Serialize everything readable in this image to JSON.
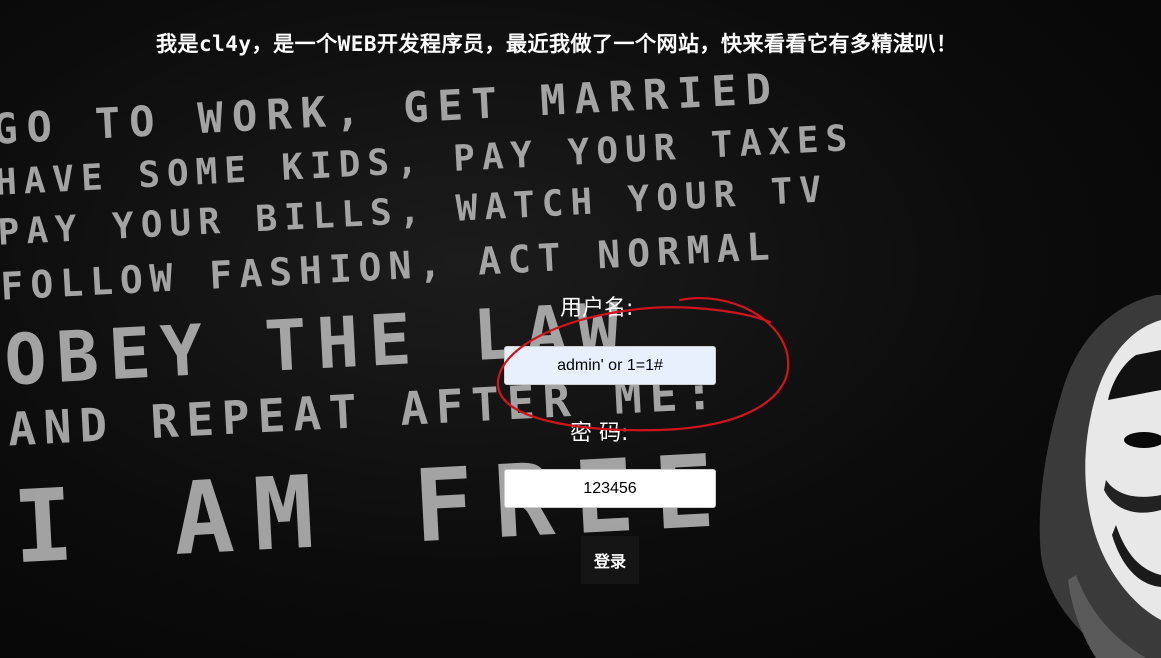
{
  "header": {
    "intro_text": "我是cl4y，是一个WEB开发程序员，最近我做了一个网站，快来看看它有多精湛叭！"
  },
  "background_poster": {
    "lines": [
      "Go to work, get married",
      "Have some kids, pay your taxes",
      "Pay your bills, watch your TV",
      "Follow fashion, act normal",
      "Obey the law",
      "And repeat after me:",
      "I am free"
    ]
  },
  "login_form": {
    "username_label": "用户名:",
    "username_value": "admin' or 1=1#",
    "password_label": "密 码:",
    "password_value": "123456",
    "submit_label": "登录"
  },
  "colors": {
    "background": "#000000",
    "text": "#ffffff",
    "annotation_circle": "#d0141c",
    "username_field_bg": "#e8f0fe",
    "button_bg": "#151515"
  },
  "icons": {
    "mask": "guy-fawkes-mask-icon"
  }
}
